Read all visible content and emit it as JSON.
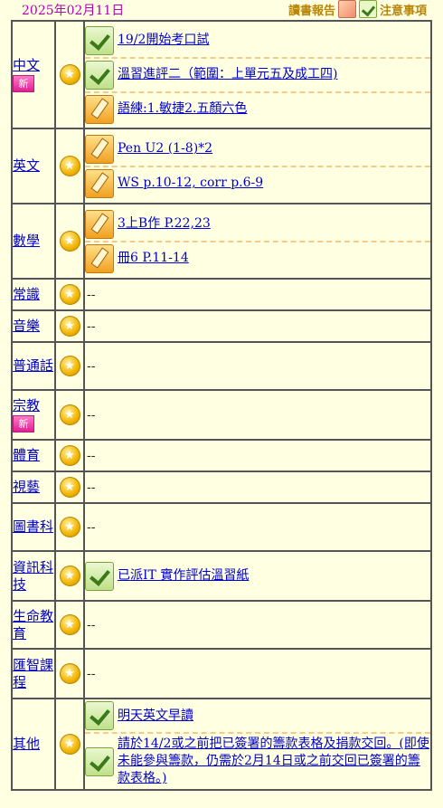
{
  "header": {
    "date": "2025年02月11日",
    "reading_report": "讀書報告",
    "notes": "注意事項"
  },
  "subjects": [
    {
      "name": "中文",
      "is_new": true,
      "new_label": "新",
      "items": [
        {
          "icon": "note-icon",
          "text": "19/2開始考口試"
        },
        {
          "icon": "note-icon",
          "text": "溫習進評二（範圍：上單元五及成工四)"
        },
        {
          "icon": "pencil-icon",
          "text": "語練:1.敏捷2.五顏六色"
        }
      ]
    },
    {
      "name": "英文",
      "is_new": false,
      "items": [
        {
          "icon": "pencil-icon",
          "text": "Pen U2 (1-8)*2"
        },
        {
          "icon": "pencil-icon",
          "text": "WS p.10-12, corr p.6-9"
        }
      ]
    },
    {
      "name": "數學",
      "is_new": false,
      "items": [
        {
          "icon": "pencil-icon",
          "text": "3上B作 P.22,23"
        },
        {
          "icon": "pencil-icon",
          "text": "冊6 P.11-14"
        }
      ]
    },
    {
      "name": "常識",
      "empty": "--"
    },
    {
      "name": "音樂",
      "empty": "--"
    },
    {
      "name": "普通話",
      "empty": "--"
    },
    {
      "name": "宗教",
      "is_new": true,
      "new_label": "新",
      "empty": "--"
    },
    {
      "name": "體育",
      "empty": "--"
    },
    {
      "name": "視藝",
      "empty": "--"
    },
    {
      "name": "圖書科",
      "empty": "--"
    },
    {
      "name": "資訊科技",
      "items": [
        {
          "icon": "note-icon",
          "text": "已派IT 實作評估溫習紙"
        }
      ]
    },
    {
      "name": "生命教育",
      "empty": "--"
    },
    {
      "name": "匯智課程",
      "empty": "--"
    },
    {
      "name": "其他",
      "items": [
        {
          "icon": "note-icon",
          "text": "明天英文早讀"
        },
        {
          "icon": "note-icon",
          "text": "請於14/2或之前把已簽署的籌款表格及捐款交回。(即使未能參與籌款，仍需於2月14日或之前交回已簽署的籌款表格。)"
        }
      ]
    }
  ]
}
